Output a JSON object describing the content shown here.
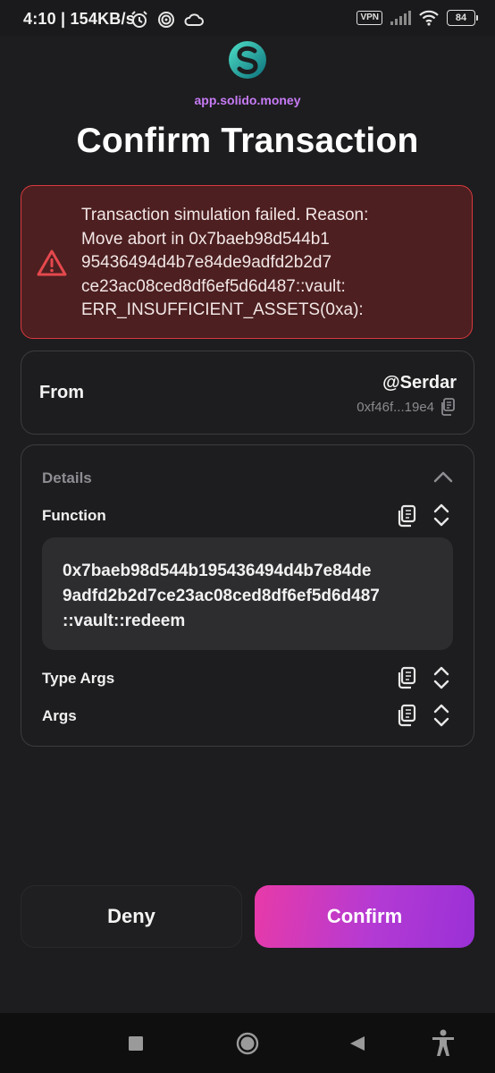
{
  "status_bar": {
    "time_speed": "4:10 | 154KB/s",
    "vpn_label": "VPN",
    "battery_level": "84",
    "icons": [
      "alarm-icon",
      "target-icon",
      "cloud-icon",
      "signal-icon",
      "wifi-icon"
    ]
  },
  "header": {
    "site_url": "app.solido.money",
    "title": "Confirm Transaction",
    "logo_icon": "solido-logo-icon"
  },
  "error": {
    "icon": "warning-icon",
    "color": "#d9393e",
    "lines": [
      "Transaction simulation failed. Reason:",
      "Move abort in 0x7baeb98d544b1",
      "95436494d4b7e84de9adfd2b2d7",
      "ce23ac08ced8df6ef5d6d487::vault:",
      "ERR_INSUFFICIENT_ASSETS(0xa):"
    ]
  },
  "from": {
    "label": "From",
    "name": "@Serdar",
    "address": "0xf46f...19e4",
    "copy_icon": "copy-icon"
  },
  "details": {
    "title": "Details",
    "collapse_icon": "chevron-up-icon",
    "function": {
      "label": "Function",
      "value_lines": [
        "0x7baeb98d544b195436494d4b7e84de",
        "9adfd2b2d7ce23ac08ced8df6ef5d6d487",
        "::vault::redeem"
      ]
    },
    "type_args": {
      "label": "Type Args"
    },
    "args": {
      "label": "Args"
    }
  },
  "actions": {
    "deny_label": "Deny",
    "confirm_label": "Confirm",
    "confirm_gradient": [
      "#e83aa8",
      "#9a30d6"
    ]
  },
  "nav_bar": {
    "icons": [
      "recents-square-icon",
      "home-circle-icon",
      "back-triangle-icon",
      "accessibility-icon"
    ]
  }
}
